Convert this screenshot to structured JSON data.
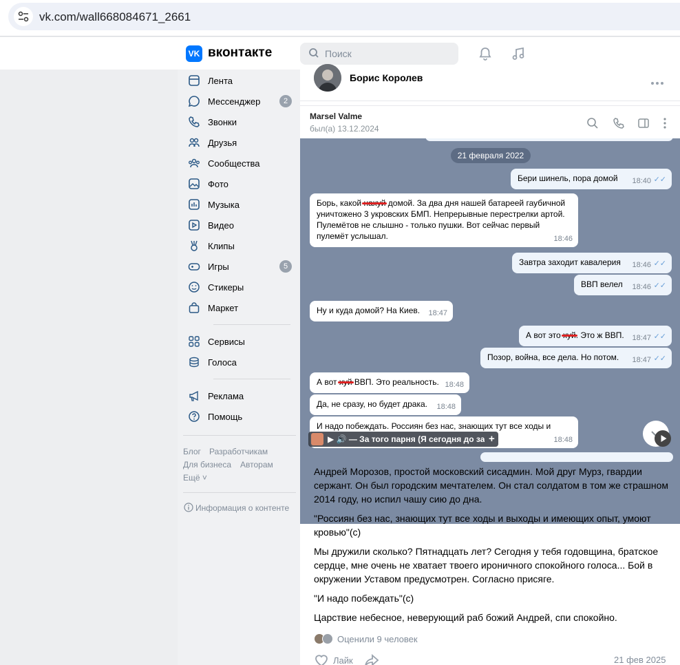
{
  "browser": {
    "url": "vk.com/wall668084671_2661"
  },
  "header": {
    "brand": "вконтакте",
    "logo_text": "VK",
    "search_placeholder": "Поиск"
  },
  "sidebar": {
    "items": [
      {
        "label": "Лента",
        "icon": "feed-icon"
      },
      {
        "label": "Мессенджер",
        "icon": "messenger-icon",
        "badge": "2"
      },
      {
        "label": "Звонки",
        "icon": "phone-icon"
      },
      {
        "label": "Друзья",
        "icon": "friends-icon"
      },
      {
        "label": "Сообщества",
        "icon": "communities-icon"
      },
      {
        "label": "Фото",
        "icon": "photo-icon"
      },
      {
        "label": "Музыка",
        "icon": "music-icon"
      },
      {
        "label": "Видео",
        "icon": "video-icon"
      },
      {
        "label": "Клипы",
        "icon": "clips-icon"
      },
      {
        "label": "Игры",
        "icon": "games-icon",
        "badge": "5"
      },
      {
        "label": "Стикеры",
        "icon": "stickers-icon"
      },
      {
        "label": "Маркет",
        "icon": "market-icon"
      }
    ],
    "items2": [
      {
        "label": "Сервисы",
        "icon": "services-icon"
      },
      {
        "label": "Голоса",
        "icon": "votes-icon"
      }
    ],
    "items3": [
      {
        "label": "Реклама",
        "icon": "ads-icon"
      },
      {
        "label": "Помощь",
        "icon": "help-icon"
      }
    ],
    "footer_links": [
      "Блог",
      "Разработчикам",
      "Для бизнеса",
      "Авторам",
      "Ещё ˅"
    ],
    "content_info": "Информация о контенте"
  },
  "post": {
    "author": "Борис Королев",
    "chat": {
      "contact_name": "Marsel Valme",
      "contact_status": "был(а) 13.12.2024",
      "date_divider": "21 февраля 2022",
      "messages": [
        {
          "dir": "out",
          "text": "Бери шинель, пора домой",
          "time": "18:40"
        },
        {
          "dir": "in",
          "text_before": "Борь, какой ",
          "censored": "нахуй",
          "text_after": " домой. За два дня нашей батареей гаубичной уничтожено 3 укровских БМП. Непрерывные перестрелки артой. Пулемётов не слышно - только пушки. Вот сейчас первый пулемёт услышал.",
          "time": "18:46"
        },
        {
          "dir": "out",
          "text": "Завтра заходит кавалерия",
          "time": "18:46"
        },
        {
          "dir": "out",
          "text": "ВВП велел",
          "time": "18:46"
        },
        {
          "dir": "in",
          "text": "Ну и куда домой? На Киев.",
          "time": "18:47"
        },
        {
          "dir": "out",
          "text_before": "А вот это ",
          "censored": "хуй",
          "text_after": ". Это ж ВВП.",
          "time": "18:47"
        },
        {
          "dir": "out",
          "text": "Позор, война, все дела. Но потом.",
          "time": "18:47"
        },
        {
          "dir": "in",
          "text_before": "А вот ",
          "censored": "хуй",
          "text_after": " ВВП. Это реальность.",
          "time": "18:48"
        },
        {
          "dir": "in",
          "text": "Да, не сразу, но будет драка.",
          "time": "18:48"
        },
        {
          "dir": "in",
          "text": "И надо побеждать. Россиян без нас, знающих тут все ходы и",
          "time": "18:48"
        }
      ],
      "audio_title": "▶ 🔊 — За того парня (Я сегодня до зари встану)",
      "audio_plus": "+"
    },
    "paragraphs": [
      "Андрей Морозов, простой московский сисадмин. Мой друг Мурз, гвардии сержант. Он был городским мечтателем. Он стал солдатом в том же страшном 2014 году, но испил чашу сию до дна.",
      "\"Россиян без нас, знающих тут все ходы и выходы и имеющих опыт, умоют кровью\"(с)",
      "Мы дружили сколько? Пятнадцать лет? Сегодня у тебя годовщина, братское сердце, мне очень не хватает твоего ироничного спокойного голоса... Бой в окружении Уставом предусмотрен. Согласно присяге.",
      "\"И надо побеждать\"(с)",
      "Царствие небесное, неверующий раб божий Андрей, спи спокойно."
    ],
    "likes_text": "Оценили 9 человек",
    "like_label": "Лайк",
    "date": "21 фев 2025"
  },
  "colors": {
    "vk_blue": "#0077ff",
    "chat_bg": "#7c8ba3",
    "sidebar_bg": "#f0f1f3"
  }
}
